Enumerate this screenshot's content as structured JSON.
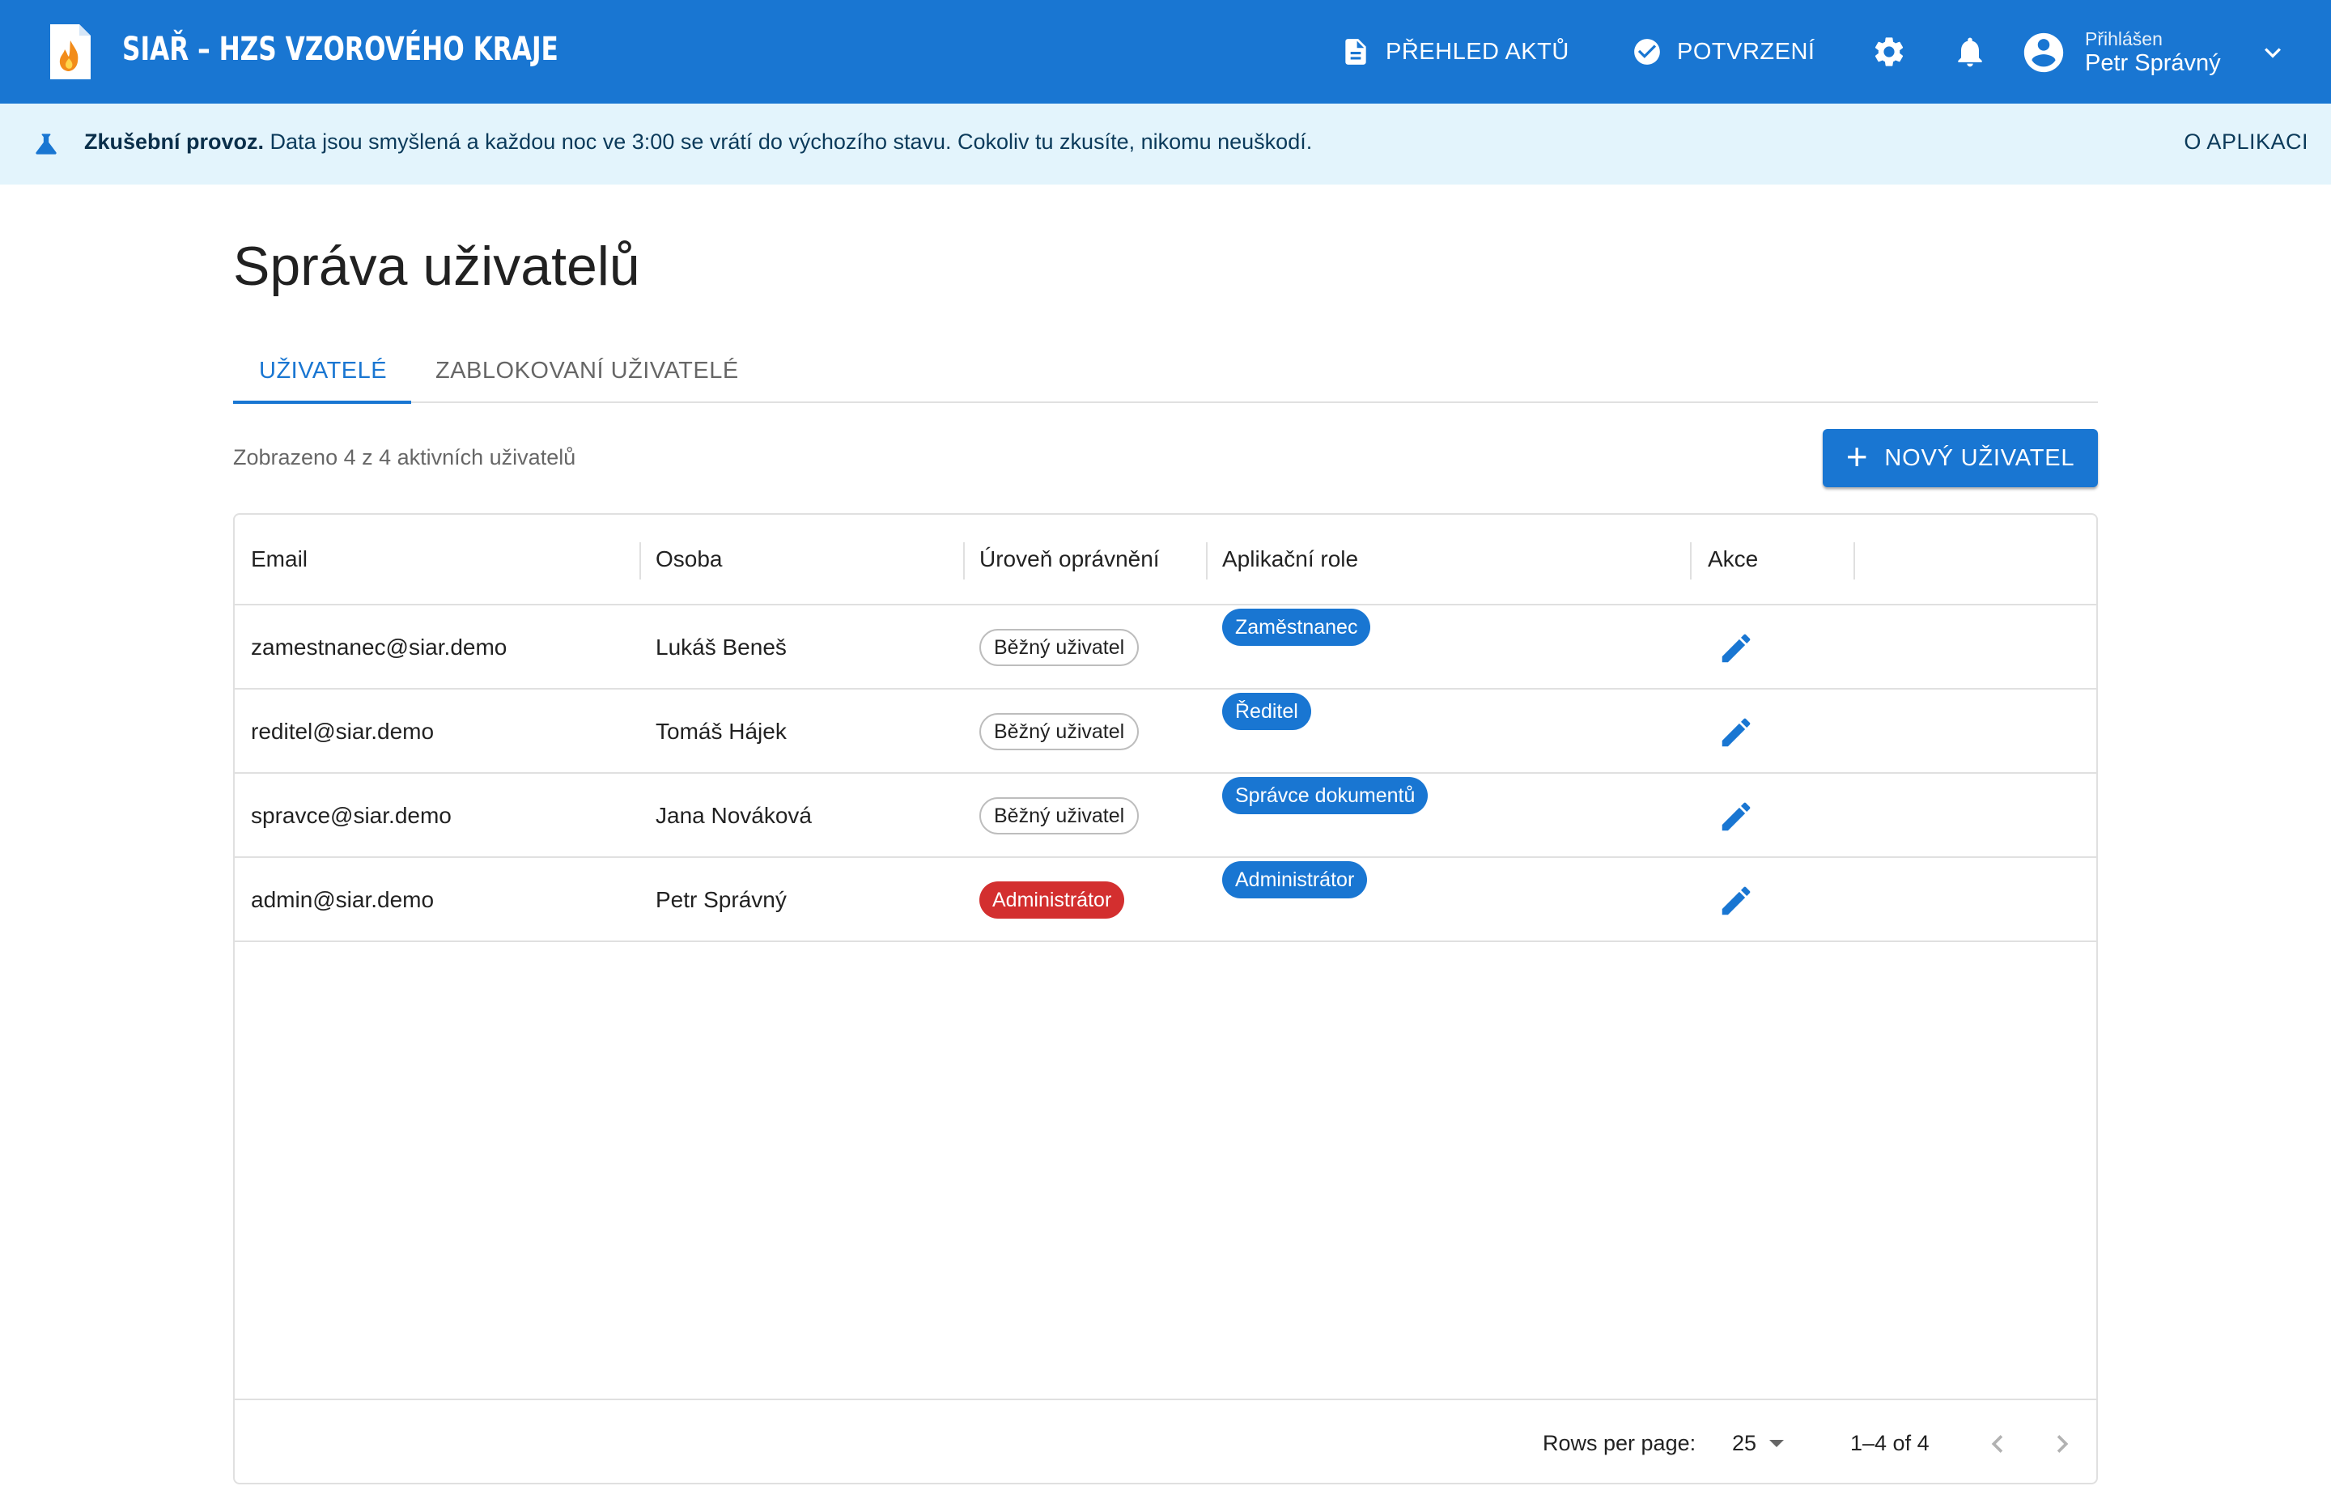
{
  "header": {
    "app_title": "SIAŘ – HZS VZOROVÉHO KRAJE",
    "nav": {
      "acts_label": "PŘEHLED AKTŮ",
      "confirm_label": "POTVRZENÍ"
    },
    "user": {
      "label": "Přihlášen",
      "name": "Petr Správný"
    },
    "colors": {
      "primary": "#1976d2"
    }
  },
  "banner": {
    "title": "Zkušební provoz.",
    "text": "Data jsou smyšlená a každou noc ve 3:00 se vrátí do výchozího stavu. Cokoliv tu zkusíte, nikomu neuškodí.",
    "about_label": "O APLIKACI"
  },
  "page": {
    "title": "Správa uživatelů",
    "tabs": [
      {
        "label": "UŽIVATELÉ",
        "active": true
      },
      {
        "label": "ZABLOKOVANÍ UŽIVATELÉ",
        "active": false
      }
    ],
    "count_text": "Zobrazeno 4 z 4 aktivních uživatelů",
    "new_user_label": "NOVÝ UŽIVATEL"
  },
  "table": {
    "columns": [
      "Email",
      "Osoba",
      "Úroveň oprávnění",
      "Aplikační role",
      "Akce"
    ],
    "rows": [
      {
        "email": "zamestnanec@siar.demo",
        "person": "Lukáš Beneš",
        "level": "Běžný uživatel",
        "level_type": "outlined",
        "role": "Zaměstnanec"
      },
      {
        "email": "reditel@siar.demo",
        "person": "Tomáš Hájek",
        "level": "Běžný uživatel",
        "level_type": "outlined",
        "role": "Ředitel"
      },
      {
        "email": "spravce@siar.demo",
        "person": "Jana Nováková",
        "level": "Běžný uživatel",
        "level_type": "outlined",
        "role": "Správce dokumentů"
      },
      {
        "email": "admin@siar.demo",
        "person": "Petr Správný",
        "level": "Administrátor",
        "level_type": "danger",
        "role": "Administrátor"
      }
    ],
    "pagination": {
      "rows_per_page_label": "Rows per page:",
      "rows_per_page": "25",
      "range": "1–4 of 4"
    }
  }
}
